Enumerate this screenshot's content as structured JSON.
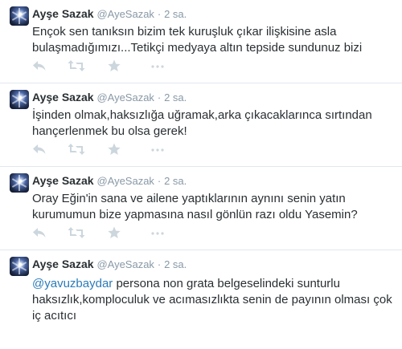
{
  "tweets": [
    {
      "name": "Ayşe Sazak",
      "handle": "@AyeSazak",
      "separator": "·",
      "time": "2 sa.",
      "mention": "",
      "text": "Ençok sen tanıksın bizim tek kuruşluk çıkar ilişkisine asla bulaşmadığımızı...Tetikçi medyaya altın tepside sundunuz bizi"
    },
    {
      "name": "Ayşe Sazak",
      "handle": "@AyeSazak",
      "separator": "·",
      "time": "2 sa.",
      "mention": "",
      "text": "İşinden olmak,haksızlığa uğramak,arka çıkacaklarınca sırtından hançerlenmek bu olsa gerek!"
    },
    {
      "name": "Ayşe Sazak",
      "handle": "@AyeSazak",
      "separator": "·",
      "time": "2 sa.",
      "mention": "",
      "text": "Oray Eğin'in sana ve ailene yaptıklarının aynını senin yatın kurumumun bize yapmasına nasıl gönlün razı oldu Yasemin?"
    },
    {
      "name": "Ayşe Sazak",
      "handle": "@AyeSazak",
      "separator": "·",
      "time": "2 sa.",
      "mention": "@yavuzbaydar",
      "text": " persona non grata belgeselindeki sunturlu haksızlık,komplocu­luk ve acımasızlıkta senin de payının olması çok iç acıtıcı"
    }
  ],
  "icons": [
    "reply-icon",
    "retweet-icon",
    "favorite-icon",
    "more-icon"
  ],
  "colors": {
    "name": "#292f33",
    "meta": "#8899a6",
    "mention": "#2b7bb9",
    "icon": "#ccd6dd",
    "divider": "#e1e8ed"
  }
}
